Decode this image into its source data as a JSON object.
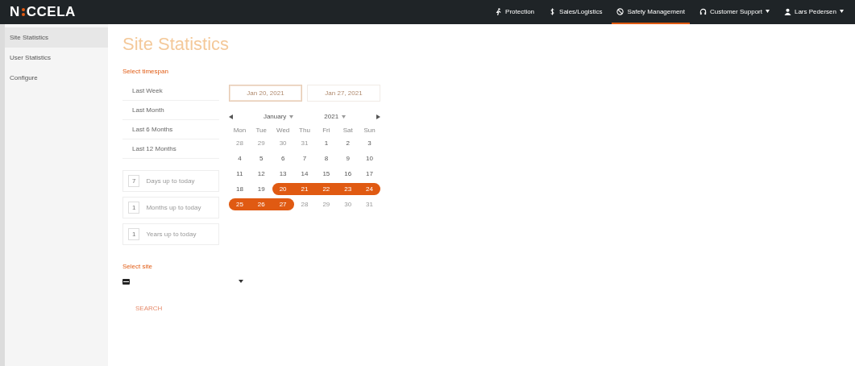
{
  "topbar": {
    "logo_left": "N",
    "logo_right": "CCELA",
    "nav": [
      {
        "label": "Protection",
        "kind": "figure",
        "selected": false,
        "caret": false
      },
      {
        "label": "Sales/Logistics",
        "kind": "dollar",
        "selected": false,
        "caret": false
      },
      {
        "label": "Safety Management",
        "kind": "ring",
        "selected": true,
        "caret": false
      },
      {
        "label": "Customer Support",
        "kind": "headset",
        "selected": false,
        "caret": true
      },
      {
        "label": "Lars Pedersen",
        "kind": "user",
        "selected": false,
        "caret": true
      }
    ]
  },
  "sidebar": {
    "items": [
      {
        "label": "Site Statistics",
        "selected": true
      },
      {
        "label": "User Statistics",
        "selected": false
      },
      {
        "label": "Configure",
        "selected": false
      }
    ]
  },
  "title": "Site Statistics",
  "timespan": {
    "label": "Select timespan",
    "options": [
      {
        "label": "Last Week"
      },
      {
        "label": "Last Month"
      },
      {
        "label": "Last 6 Months"
      },
      {
        "label": "Last 12 Months"
      }
    ],
    "custom": [
      {
        "value": "7",
        "label": "Days up to today"
      },
      {
        "value": "1",
        "label": "Months up to today"
      },
      {
        "value": "1",
        "label": "Years up to today"
      }
    ]
  },
  "dates": {
    "from": "Jan 20, 2021",
    "to": "Jan 27, 2021"
  },
  "calendar": {
    "month": "January",
    "year": "2021",
    "weekdays": [
      "Mon",
      "Tue",
      "Wed",
      "Thu",
      "Fri",
      "Sat",
      "Sun"
    ],
    "weeks": [
      [
        {
          "day": "28",
          "outside": true,
          "selected": false
        },
        {
          "day": "29",
          "outside": true,
          "selected": false
        },
        {
          "day": "30",
          "outside": true,
          "selected": false
        },
        {
          "day": "31",
          "outside": true,
          "selected": false
        },
        {
          "day": "1",
          "outside": false,
          "selected": false
        },
        {
          "day": "2",
          "outside": false,
          "selected": false
        },
        {
          "day": "3",
          "outside": false,
          "selected": false
        }
      ],
      [
        {
          "day": "4",
          "outside": false,
          "selected": false
        },
        {
          "day": "5",
          "outside": false,
          "selected": false
        },
        {
          "day": "6",
          "outside": false,
          "selected": false
        },
        {
          "day": "7",
          "outside": false,
          "selected": false
        },
        {
          "day": "8",
          "outside": false,
          "selected": false
        },
        {
          "day": "9",
          "outside": false,
          "selected": false
        },
        {
          "day": "10",
          "outside": false,
          "selected": false
        }
      ],
      [
        {
          "day": "11",
          "outside": false,
          "selected": false
        },
        {
          "day": "12",
          "outside": false,
          "selected": false
        },
        {
          "day": "13",
          "outside": false,
          "selected": false
        },
        {
          "day": "14",
          "outside": false,
          "selected": false
        },
        {
          "day": "15",
          "outside": false,
          "selected": false
        },
        {
          "day": "16",
          "outside": false,
          "selected": false
        },
        {
          "day": "17",
          "outside": false,
          "selected": false
        }
      ],
      [
        {
          "day": "18",
          "outside": false,
          "selected": false
        },
        {
          "day": "19",
          "outside": false,
          "selected": false
        },
        {
          "day": "20",
          "outside": false,
          "selected": true
        },
        {
          "day": "21",
          "outside": false,
          "selected": true
        },
        {
          "day": "22",
          "outside": false,
          "selected": true
        },
        {
          "day": "23",
          "outside": false,
          "selected": true
        },
        {
          "day": "24",
          "outside": false,
          "selected": true
        }
      ],
      [
        {
          "day": "25",
          "outside": false,
          "selected": true
        },
        {
          "day": "26",
          "outside": false,
          "selected": true
        },
        {
          "day": "27",
          "outside": false,
          "selected": true
        },
        {
          "day": "28",
          "outside": true,
          "selected": false
        },
        {
          "day": "29",
          "outside": true,
          "selected": false
        },
        {
          "day": "30",
          "outside": true,
          "selected": false
        },
        {
          "day": "31",
          "outside": true,
          "selected": false
        }
      ]
    ]
  },
  "site": {
    "label": "Select site"
  },
  "search_button": "SEARCH"
}
